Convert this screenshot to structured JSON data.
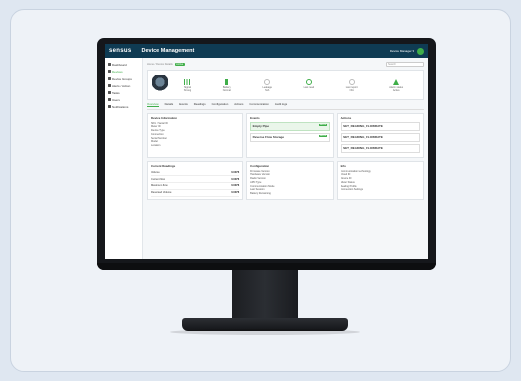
{
  "app": {
    "logo": "sensus",
    "title": "Device Management",
    "user": "Device Manager ▾"
  },
  "sidebar": {
    "items": [
      "Dashboard",
      "Devices",
      "Device Groups",
      "Alerts / Action",
      "Tasks",
      "Users",
      "Notifications"
    ]
  },
  "crumbs": {
    "path": "Home / Device Details",
    "status": "Active",
    "search_placeholder": "Search"
  },
  "stats": [
    {
      "label": "Signal",
      "value": "Strong"
    },
    {
      "label": "Battery",
      "value": "Normal"
    },
    {
      "label": "Leakage",
      "value": "N/A"
    },
    {
      "label": "Last read",
      "value": ""
    },
    {
      "label": "Last report",
      "value": "N/A"
    },
    {
      "label": "Alarm status",
      "value": "Active"
    }
  ],
  "tabs": [
    "Overview",
    "Details",
    "Events",
    "Readings",
    "Configuration",
    "Actions",
    "Communication",
    "Audit logs"
  ],
  "cards": {
    "device_info": {
      "title": "Device Information",
      "lines": [
        "SKU / Serial ID",
        "Meter ID",
        "Device Type",
        "Connection",
        "Serial Number",
        "Model",
        "Location"
      ]
    },
    "events": {
      "title": "Events",
      "items": [
        "Empty Pipe",
        "Reverse Flow Storage"
      ],
      "tag": "Active"
    },
    "actions": {
      "title": "Actions",
      "items": [
        "SET_READING_FLOWRATE",
        "SET_READING_FLOWRATE",
        "SET_READING_FLOWRATE"
      ]
    },
    "current_readings": {
      "title": "Current Readings",
      "rows": [
        [
          "Volume",
          "0.0076"
        ],
        [
          "Current flow",
          "0.0076"
        ],
        [
          "Maximum flow",
          "0.0076"
        ],
        [
          "Reversed Volume",
          "0.0076"
        ]
      ]
    },
    "configuration": {
      "title": "Configuration",
      "lines": [
        "Firmware Version",
        "Hardware Version",
        "Radio Version",
        "APN Type",
        "Communication Mode",
        "Last Session",
        "Battery Remaining"
      ]
    },
    "info": {
      "title": "Info",
      "lines": [
        "Communication technology",
        "Cloud ID",
        "Device ID",
        "Meter Status",
        "Sealing Profile",
        "Connection Settings"
      ]
    }
  },
  "colors": {
    "accent": "#3fae49",
    "topbar": "#0f3b53"
  }
}
